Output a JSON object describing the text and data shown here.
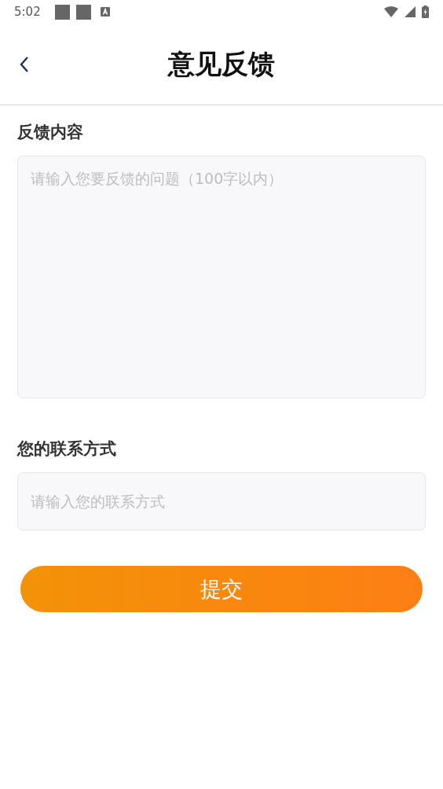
{
  "status_bar": {
    "time": "5:02"
  },
  "header": {
    "title": "意见反馈"
  },
  "fields": [
    {
      "kind": "textarea",
      "label": "反馈内容",
      "placeholder": "请输入您要反馈的问题（100字以内）"
    },
    {
      "kind": "input",
      "label": "您的联系方式",
      "placeholder": "请输入您的联系方式"
    }
  ],
  "submit_button": {
    "label": "提交"
  }
}
